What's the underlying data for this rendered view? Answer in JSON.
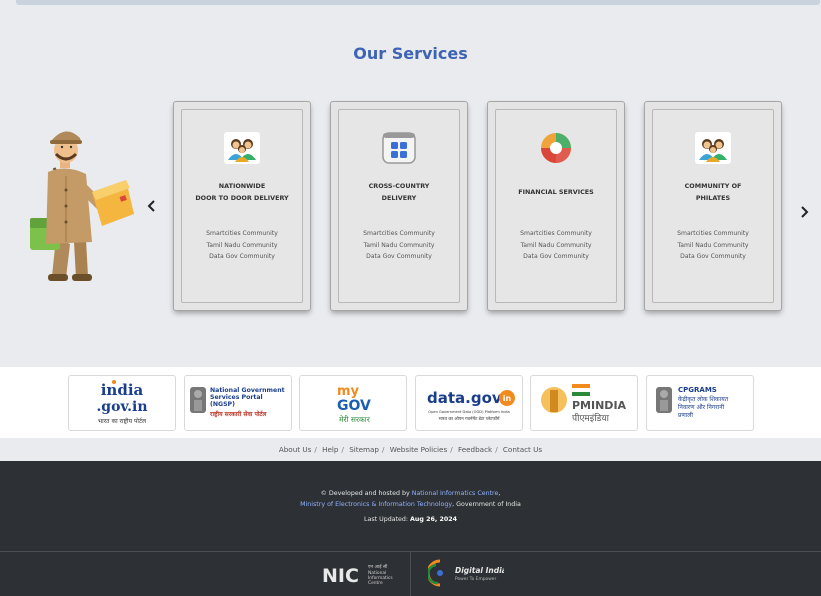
{
  "services": {
    "title": "Our Services",
    "cards": [
      {
        "name_line1": "NATIONWIDE",
        "name_line2": "DOOR TO DOOR DELIVERY",
        "icon": "community-icon",
        "links": [
          "Smartcities Community",
          "Tamil Nadu Community",
          "Data Gov Community"
        ]
      },
      {
        "name_line1": "CROSS-COUNTRY",
        "name_line2": "DELIVERY",
        "icon": "apps-grid-icon",
        "links": [
          "Smartcities Community",
          "Tamil Nadu Community",
          "Data Gov Community"
        ]
      },
      {
        "name_line1": "FINANCIAL SERVICES",
        "name_line2": "",
        "icon": "pie-chart-icon",
        "links": [
          "Smartcities Community",
          "Tamil Nadu Community",
          "Data Gov Community"
        ]
      },
      {
        "name_line1": "COMMUNITY OF",
        "name_line2": "PHILATES",
        "icon": "community-icon",
        "links": [
          "Smartcities Community",
          "Tamil Nadu Community",
          "Data Gov Community"
        ]
      }
    ]
  },
  "partners": [
    {
      "id": "india-gov",
      "line1": "india",
      "line2": ".gov.in",
      "line3": "भारत का राष्ट्रीय पोर्टल"
    },
    {
      "id": "ngsp",
      "line1": "National Government",
      "line2": "Services Portal",
      "line3": "(NGSP)",
      "line4": "राष्ट्रीय सरकारी सेवा पोर्टल"
    },
    {
      "id": "mygov",
      "line1": "my",
      "line2": "GOV",
      "line3": "मेरी सरकार"
    },
    {
      "id": "datagov",
      "line1": "data.gov",
      "line2": "in",
      "line3": "Open Government Data (OGD) Platform India",
      "line4": "भारत का ओपन गवर्नमेंट डेटा प्लेटफॉर्म"
    },
    {
      "id": "pmindia",
      "line1": "PMINDIA",
      "line2": "पीएमइंडिया"
    },
    {
      "id": "cpgrams",
      "line1": "CPGRAMS",
      "line2": "केंद्रीकृत लोक शिकायत",
      "line3": "निवारण और निगरानी",
      "line4": "प्रणाली"
    }
  ],
  "footer_links": [
    "About Us",
    "Help",
    "Sitemap",
    "Website Policies",
    "Feedback",
    "Contact Us"
  ],
  "footer": {
    "credit_prefix": "© Developed and hosted by ",
    "credit_org": "National Informatics Centre",
    "credit_comma": ",",
    "ministry": "Ministry of Electronics & Information Technology",
    "gov": ", Government of India",
    "updated_label": "Last Updated: ",
    "updated_date": "Aug 26, 2024",
    "nic_hindi": "एन आई सी",
    "nic_line1": "National",
    "nic_line2": "Informatics",
    "nic_line3": "Centre",
    "digital_title": "Digital India",
    "digital_tag": "Power To Empower"
  },
  "colors": {
    "title": "#3f63b4",
    "footer_bg": "#2d3034",
    "link": "#8fb3ff"
  }
}
